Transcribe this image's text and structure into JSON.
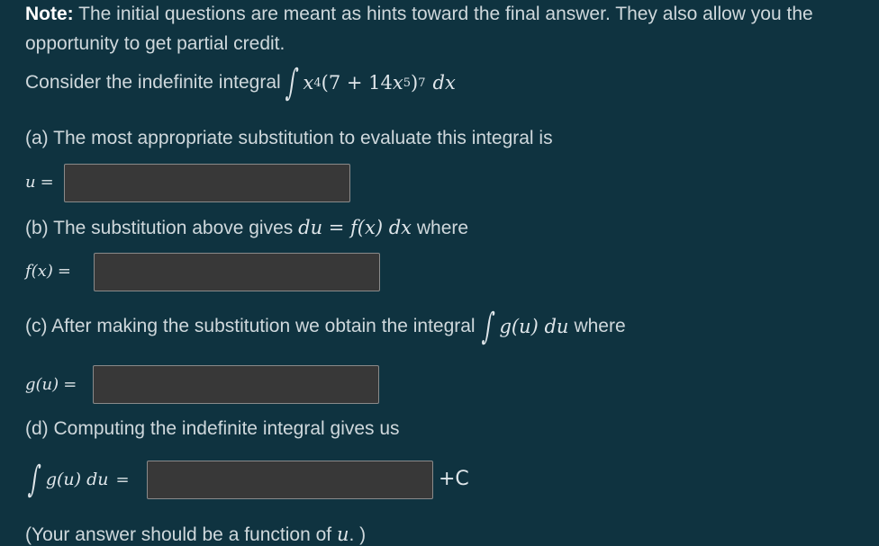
{
  "note": {
    "label": "Note:",
    "line1": " The initial questions are meant as hints toward the final answer. They also allow you the",
    "line2": "opportunity to get partial credit."
  },
  "intro": {
    "prefix": "Consider the indefinite integral",
    "integrand_x": "x",
    "x_power": "4",
    "paren_open": "(7 + 14",
    "inner_x": "x",
    "inner_power": "5",
    "paren_close": ")",
    "outer_power": "7",
    "dx": "dx"
  },
  "part_a": {
    "text": "(a) The most appropriate substitution to evaluate this integral is",
    "var": "u",
    "eq": "=",
    "value": ""
  },
  "part_b": {
    "text": "(b) The substitution above gives",
    "eq_expr": "du = f(x) dx",
    "where": "where",
    "var": "f(x)",
    "eq": "=",
    "value": ""
  },
  "part_c": {
    "text": "(c) After making the substitution we obtain the integral",
    "expr": "g(u) du",
    "where": "where",
    "var": "g(u)",
    "eq": "=",
    "value": ""
  },
  "part_d": {
    "text": "(d) Computing the indefinite integral gives us",
    "expr": "g(u) du",
    "eq": "=",
    "value": "",
    "constant": "+C"
  },
  "footer": {
    "text": "(Your answer should be a function of",
    "var": "u",
    "end": ". )"
  }
}
